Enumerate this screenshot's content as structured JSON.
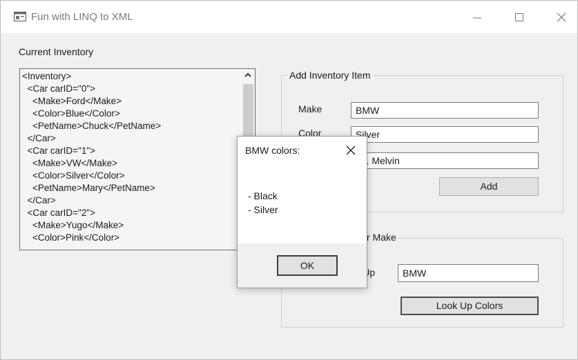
{
  "window": {
    "title": "Fun with LINQ to XML"
  },
  "inventory_section": {
    "label": "Current Inventory"
  },
  "xml_lines": [
    "<Inventory>",
    "  <Car carID=\"0\">",
    "    <Make>Ford</Make>",
    "    <Color>Blue</Color>",
    "    <PetName>Chuck</PetName>",
    "  </Car>",
    "  <Car carID=\"1\">",
    "    <Make>VW</Make>",
    "    <Color>Silver</Color>",
    "    <PetName>Mary</PetName>",
    "  </Car>",
    "  <Car carID=\"2\">",
    "    <Make>Yugo</Make>",
    "    <Color>Pink</Color>"
  ],
  "add_group": {
    "title": "Add Inventory Item",
    "make_label": "Make",
    "make_value": "BMW",
    "color_label": "Color",
    "color_value": "Silver",
    "petname_value": "Mr. Melvin",
    "add_button": "Add"
  },
  "lookup_group": {
    "title": "Look Up Colors for Make",
    "lookup_label": "Look Up",
    "make_value": "BMW",
    "lookup_button": "Look Up Colors"
  },
  "dialog": {
    "title": "BMW colors:",
    "lines": [
      "- Black",
      "- Silver"
    ],
    "ok_button": "OK"
  },
  "icons": {
    "app": "app-window-icon",
    "minimize": "minimize-icon",
    "maximize": "maximize-icon",
    "close": "close-icon",
    "scroll_up": "scroll-up-arrow-icon",
    "dialog_close": "dialog-close-icon"
  }
}
